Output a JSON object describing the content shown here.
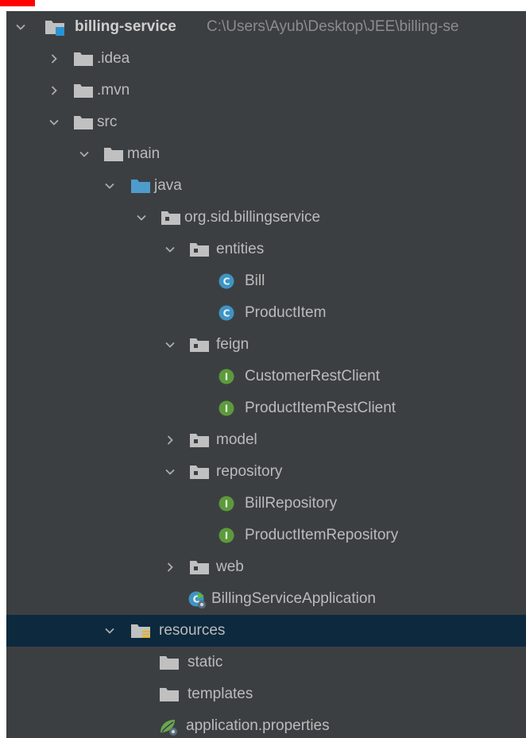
{
  "project": {
    "name": "billing-service",
    "path": "C:\\Users\\Ayub\\Desktop\\JEE\\billing-se"
  },
  "tree": {
    "idea": ".idea",
    "mvn": ".mvn",
    "src": "src",
    "main": "main",
    "java": "java",
    "package": "org.sid.billingservice",
    "entities": "entities",
    "bill": "Bill",
    "product_item": "ProductItem",
    "feign": "feign",
    "customer_rest_client": "CustomerRestClient",
    "product_item_rest_client": "ProductItemRestClient",
    "model": "model",
    "repository": "repository",
    "bill_repository": "BillRepository",
    "product_item_repository": "ProductItemRepository",
    "web": "web",
    "app_class": "BillingServiceApplication",
    "resources": "resources",
    "static": "static",
    "templates": "templates",
    "app_properties": "application.properties"
  },
  "colors": {
    "panel_bg": "#3c3f41",
    "selected_row": "#0d293e",
    "text": "#bbbbbb",
    "folder": "#c0c0c0",
    "source_folder": "#4e9bcd",
    "class_icon": "#3f94c4",
    "interface_icon": "#5c9a3c"
  },
  "icons": {
    "folder": "folder-icon",
    "package": "package-icon",
    "class": "class-icon",
    "interface": "interface-icon",
    "spring_boot": "spring-boot-icon",
    "spring_config": "spring-config-icon"
  }
}
